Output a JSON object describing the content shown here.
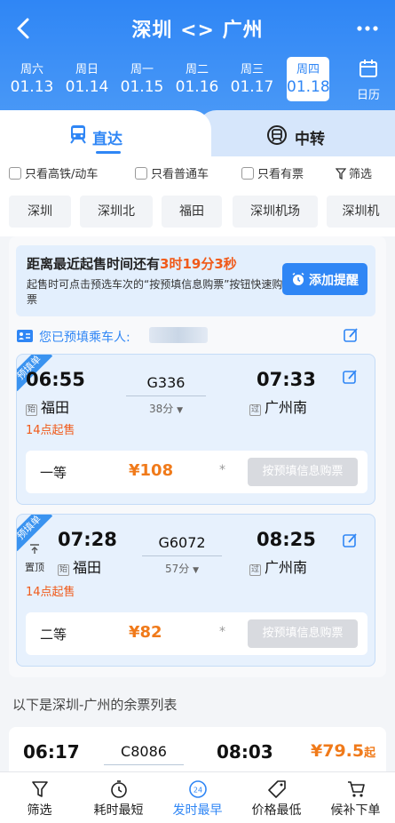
{
  "header": {
    "title": "深圳 <> 广州",
    "back_icon": "chevron-left-icon",
    "more_icon": "more-dots-icon"
  },
  "dates": [
    {
      "weekday": "周六",
      "date": "01.13",
      "selected": false
    },
    {
      "weekday": "周日",
      "date": "01.14",
      "selected": false
    },
    {
      "weekday": "周一",
      "date": "01.15",
      "selected": false
    },
    {
      "weekday": "周二",
      "date": "01.16",
      "selected": false
    },
    {
      "weekday": "周三",
      "date": "01.17",
      "selected": false
    },
    {
      "weekday": "周四",
      "date": "01.18",
      "selected": true
    }
  ],
  "calendar": {
    "label": "日历",
    "icon": "calendar-icon"
  },
  "tabs": {
    "direct": "直达",
    "transfer": "中转",
    "active": "direct"
  },
  "filters": [
    "只看高铁/动车",
    "只看普通车",
    "只看有票",
    "筛选"
  ],
  "stations": [
    "深圳",
    "深圳北",
    "福田",
    "深圳机场",
    "深圳机"
  ],
  "banner": {
    "line1_prefix": "距离最近起售时间还有",
    "countdown": "3时19分3秒",
    "line2": "起售时可点击预选车次的“按预填信息购票”按钮快速购票",
    "remind_button": "添加提醒"
  },
  "passenger": {
    "label": "您已预填乘车人:"
  },
  "trains": [
    {
      "ribbon": "预填单",
      "depart_time": "06:55",
      "depart_tag": "始",
      "depart_station": "福田",
      "train_no": "G336",
      "duration": "38分",
      "arrive_time": "07:33",
      "arrive_tag": "过",
      "arrive_station": "广州南",
      "sale_note": "14点起售",
      "seat_class": "一等",
      "price": "¥108",
      "star": "*",
      "buy_button": "按预填信息购票"
    },
    {
      "ribbon": "预填单",
      "pin_label": "置顶",
      "depart_time": "07:28",
      "depart_tag": "始",
      "depart_station": "福田",
      "train_no": "G6072",
      "duration": "57分",
      "arrive_time": "08:25",
      "arrive_tag": "过",
      "arrive_station": "广州南",
      "sale_note": "14点起售",
      "seat_class": "二等",
      "price": "¥82",
      "star": "*",
      "buy_button": "按预填信息购票"
    }
  ],
  "list_section": {
    "title": "以下是深圳-广州的余票列表",
    "first_train": {
      "depart_time": "06:17",
      "train_no": "C8086",
      "arrive_time": "08:03",
      "price": "¥79.5",
      "price_suffix": "起"
    }
  },
  "bottom_nav": [
    {
      "label": "筛选",
      "icon": "filter-icon",
      "active": false
    },
    {
      "label": "耗时最短",
      "icon": "timer-icon",
      "active": false
    },
    {
      "label": "发时最早",
      "icon": "clock-24-icon",
      "active": true
    },
    {
      "label": "价格最低",
      "icon": "price-tag-icon",
      "active": false
    },
    {
      "label": "候补下单",
      "icon": "cart-icon",
      "active": false
    }
  ],
  "colors": {
    "accent": "#2f86f5",
    "highlight": "#f05a1a",
    "price": "#f07a1a"
  }
}
